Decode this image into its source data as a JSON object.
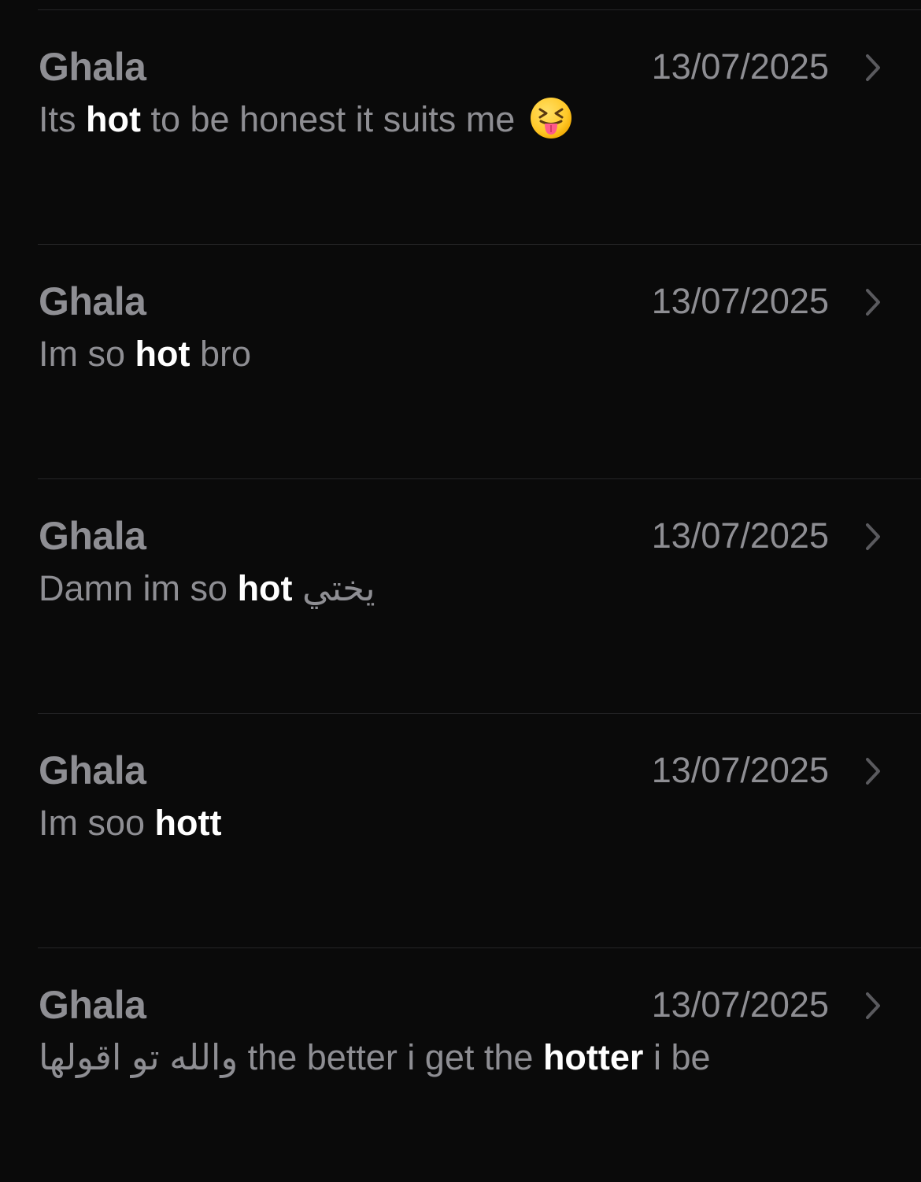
{
  "results": [
    {
      "sender": "Ghala",
      "date": "13/07/2025",
      "chevron_icon": "chevron-right-icon",
      "message": {
        "before": "Its ",
        "highlight": "hot",
        "after": " to be honest it suits me ",
        "emoji": "😝"
      }
    },
    {
      "sender": "Ghala",
      "date": "13/07/2025",
      "chevron_icon": "chevron-right-icon",
      "message": {
        "before": "Im so ",
        "highlight": "hot",
        "after": " bro"
      }
    },
    {
      "sender": "Ghala",
      "date": "13/07/2025",
      "chevron_icon": "chevron-right-icon",
      "message": {
        "before": "Damn im so ",
        "highlight": "hot",
        "after": " يختي"
      }
    },
    {
      "sender": "Ghala",
      "date": "13/07/2025",
      "chevron_icon": "chevron-right-icon",
      "message": {
        "before": "Im soo ",
        "highlight": "hott",
        "after": ""
      }
    },
    {
      "sender": "Ghala",
      "date": "13/07/2025",
      "chevron_icon": "chevron-right-icon",
      "message": {
        "before": "والله تو اقولها the better i get the ",
        "highlight": "hotter",
        "after": " i be"
      }
    }
  ],
  "colors": {
    "background": "#0a0a0a",
    "secondary_text": "#8e8e93",
    "highlight_text": "#ffffff",
    "divider": "#262628",
    "chevron": "#5a5a5e"
  }
}
